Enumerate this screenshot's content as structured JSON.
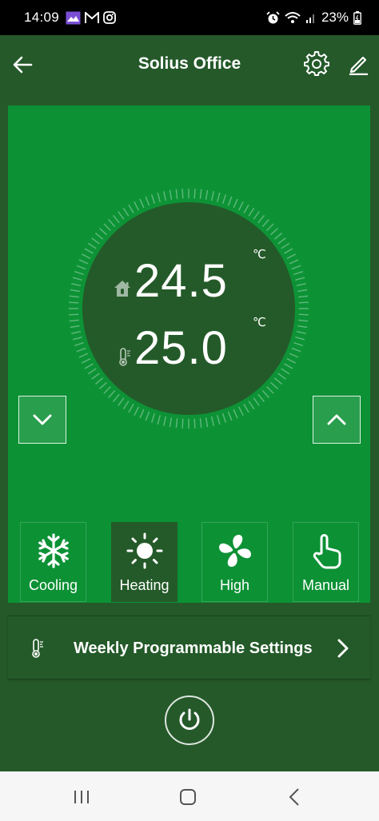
{
  "status_bar": {
    "time": "14:09",
    "battery_percent": "23%",
    "left_icons": [
      "gallery-icon",
      "gmail-icon",
      "instagram-icon"
    ],
    "right_icons": [
      "alarm-icon",
      "wifi-icon",
      "signal-icon",
      "battery-icon"
    ]
  },
  "header": {
    "title": "Solius Office"
  },
  "thermostat": {
    "current_temp": "24.5",
    "current_unit": "℃",
    "target_temp": "25.0",
    "target_unit": "℃"
  },
  "modes": [
    {
      "label": "Cooling",
      "icon": "snowflake-icon",
      "active": false
    },
    {
      "label": "Heating",
      "icon": "sun-icon",
      "active": true
    },
    {
      "label": "High",
      "icon": "fan-icon",
      "active": false
    },
    {
      "label": "Manual",
      "icon": "hand-pointer-icon",
      "active": false
    }
  ],
  "weekly": {
    "label": "Weekly Programmable Settings"
  },
  "colors": {
    "background": "#25592a",
    "panel": "#0c9135",
    "dial_inner": "#245a29",
    "active_mode": "#245a29"
  }
}
